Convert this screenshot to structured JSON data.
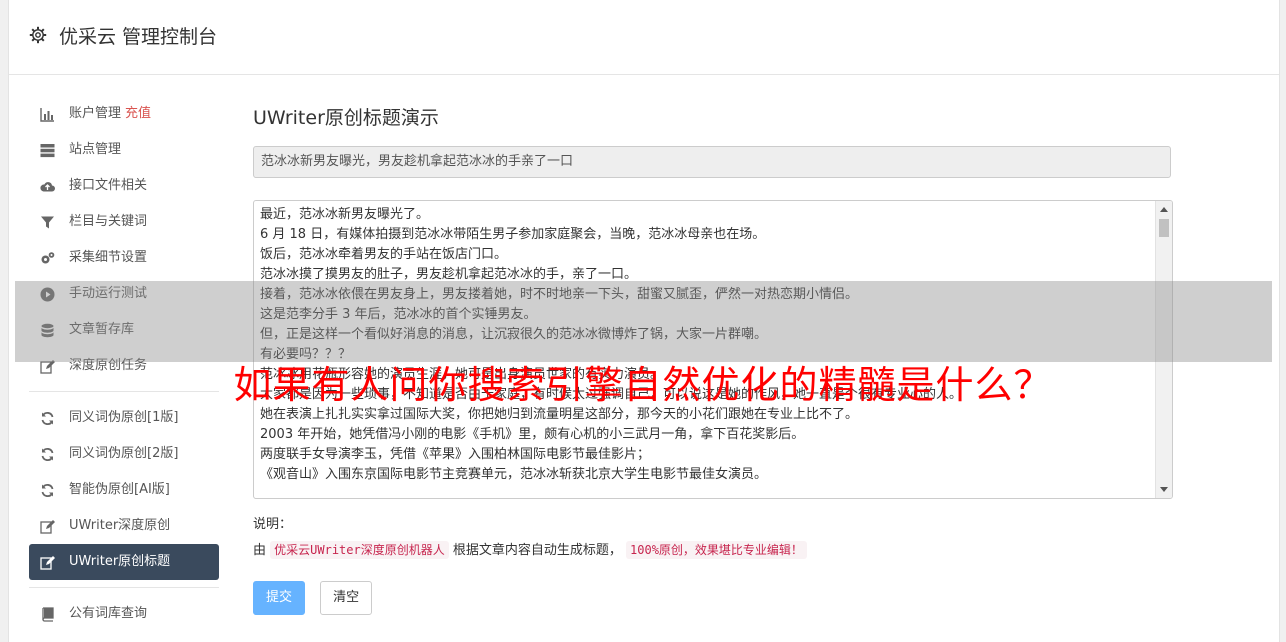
{
  "header": {
    "title": "优采云 管理控制台",
    "icon": "gear-icon"
  },
  "sidebar": {
    "group1": [
      {
        "label": "账户管理",
        "badge": "充值",
        "icon": "bar-chart-icon"
      },
      {
        "label": "站点管理",
        "icon": "server-icon"
      },
      {
        "label": "接口文件相关",
        "icon": "cloud-upload-icon"
      },
      {
        "label": "栏目与关键词",
        "icon": "filter-icon"
      },
      {
        "label": "采集细节设置",
        "icon": "cogs-icon"
      },
      {
        "label": "手动运行测试",
        "icon": "play-circle-icon"
      },
      {
        "label": "文章暂存库",
        "icon": "database-icon"
      },
      {
        "label": "深度原创任务",
        "icon": "edit-icon"
      }
    ],
    "group2": [
      {
        "label": "同义词伪原创[1版]",
        "icon": "refresh-icon"
      },
      {
        "label": "同义词伪原创[2版]",
        "icon": "refresh-icon"
      },
      {
        "label": "智能伪原创[AI版]",
        "icon": "refresh-icon"
      },
      {
        "label": "UWriter深度原创",
        "icon": "edit-icon"
      },
      {
        "label": "UWriter原创标题",
        "icon": "edit-icon",
        "active": true
      }
    ],
    "group3": [
      {
        "label": "公有词库查询",
        "icon": "book-icon"
      }
    ]
  },
  "main": {
    "heading": "UWriter原创标题演示",
    "title_value": "范冰冰新男友曝光，男友趁机拿起范冰冰的手亲了一口",
    "article_lines": [
      "最近，范冰冰新男友曝光了。",
      "6 月 18 日，有媒体拍摄到范冰冰带陌生男子参加家庭聚会，当晚，范冰冰母亲也在场。",
      "饭后，范冰冰牵着男友的手站在饭店门口。",
      "范冰冰摸了摸男友的肚子，男友趁机拿起范冰冰的手，亲了一口。",
      "接着，范冰冰依偎在男友身上，男友搂着她，时不时地亲一下头，甜蜜又腻歪，俨然一对热恋期小情侣。",
      "这是范李分手 3 年后，范冰冰的首个实锤男友。",
      "但，正是这样一个看似好消息的消息，让沉寂很久的范冰冰微博炸了锅，大家一片群嘲。",
      "有必要吗？？？",
      "范冰冰用花瓶形容她的演员生涯，她可是出身演员世家的有实力演员。",
      "大家都是因为一些琐事，不知道是否由于家庭，有时候太过强调自己，可以说这是她的作风，她一直是个很有专业心的人。",
      "她在表演上扎扎实实拿过国际大奖，你把她归到流量明星这部分，那今天的小花们跟她在专业上比不了。",
      "2003 年开始，她凭借冯小刚的电影《手机》里，颇有心机的小三武月一角，拿下百花奖影后。",
      "两度联手女导演李玉，凭借《苹果》入围柏林国际电影节最佳影片；",
      "《观音山》入围东京国际电影节主竞赛单元，范冰冰斩获北京大学生电影节最佳女演员。"
    ],
    "desc_label": "说明：",
    "desc_prefix": "由",
    "desc_code1": "优采云UWriter深度原创机器人",
    "desc_middle": "根据文章内容自动生成标题，",
    "desc_code2": "100%原创，效果堪比专业编辑！",
    "submit_label": "提交",
    "clear_label": "清空"
  },
  "overlay": {
    "text": "如果有人问你搜索引擎自然优化的精髓是什么？"
  },
  "colors": {
    "accent_blue": "#66b3ff",
    "active_nav": "#3a4a5d",
    "badge_red": "#d9534f",
    "overlay_text": "#ff0000"
  }
}
